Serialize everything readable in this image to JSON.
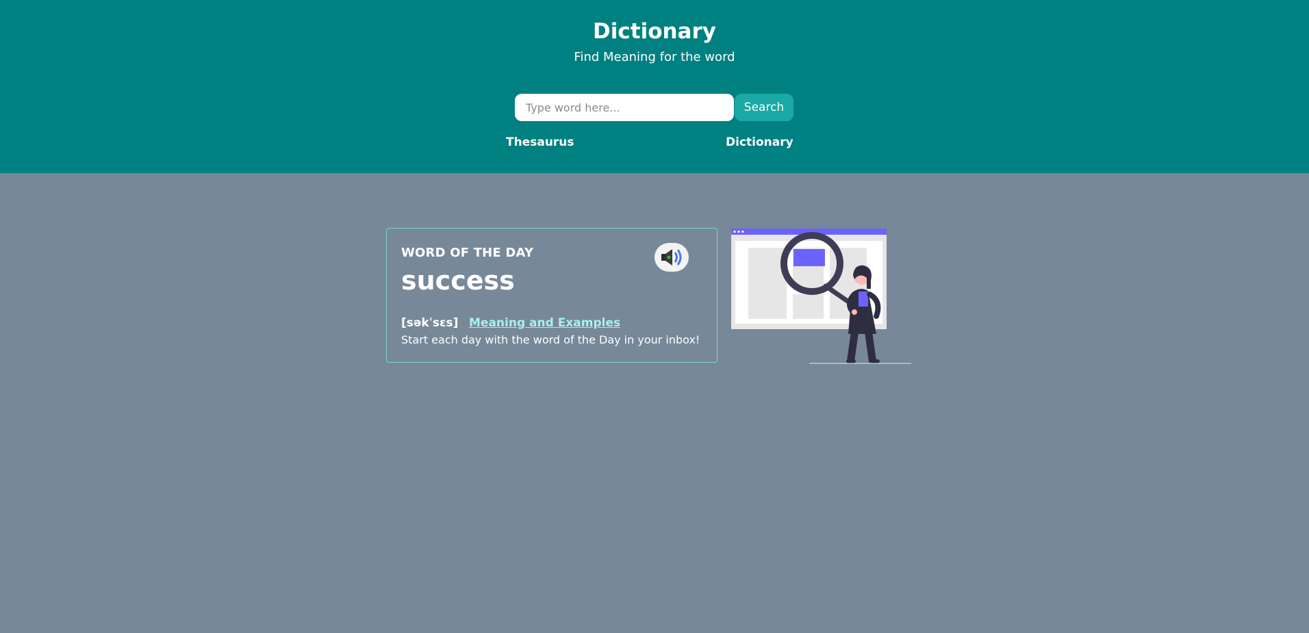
{
  "header": {
    "title": "Dictionary",
    "subtitle": "Find Meaning for the word",
    "background_color": "#008080"
  },
  "search": {
    "placeholder": "Type word here...",
    "value": "",
    "button_label": "Search",
    "button_color": "#1aa9a4"
  },
  "nav": {
    "thesaurus": "Thesaurus",
    "dictionary": "Dictionary"
  },
  "word_of_the_day": {
    "label": "WORD OF THE DAY",
    "word": "success",
    "pronunciation": "[səkˈsɛs]",
    "meaning_link": "Meaning and Examples",
    "description": "Start each day with the word of the Day in your inbox!",
    "audio_icon": "speaker-icon"
  },
  "illustration": {
    "icon": "magnifier-person-illustration",
    "accent_color": "#6c63ff"
  },
  "page": {
    "background_color": "#778899"
  }
}
